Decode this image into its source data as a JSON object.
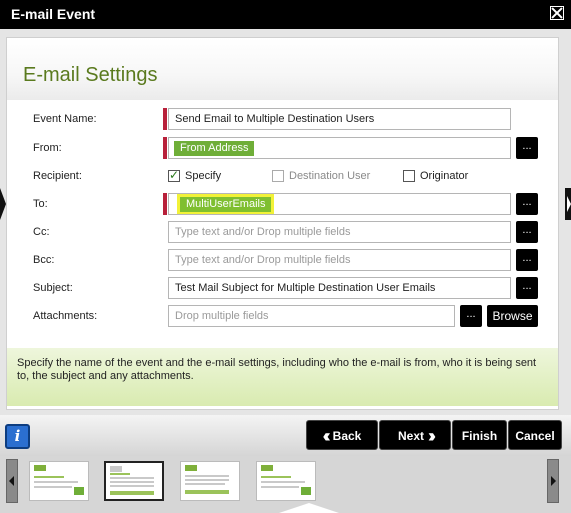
{
  "window": {
    "title": "E-mail Event"
  },
  "heading": "E-mail Settings",
  "form": {
    "event_name": {
      "label": "Event Name:",
      "value": "Send Email to Multiple Destination Users"
    },
    "from": {
      "label": "From:",
      "token": "From Address"
    },
    "recipient": {
      "label": "Recipient:",
      "options": [
        {
          "label": "Specify",
          "checked": true,
          "enabled": true
        },
        {
          "label": "Destination User",
          "checked": false,
          "enabled": false
        },
        {
          "label": "Originator",
          "checked": false,
          "enabled": true
        }
      ]
    },
    "to": {
      "label": "To:",
      "token": "MultiUserEmails"
    },
    "cc": {
      "label": "Cc:",
      "placeholder": "Type text and/or Drop multiple fields"
    },
    "bcc": {
      "label": "Bcc:",
      "placeholder": "Type text and/or Drop multiple fields"
    },
    "subject": {
      "label": "Subject:",
      "value": "Test Mail Subject  for Multiple Destination User Emails"
    },
    "attachments": {
      "label": "Attachments:",
      "placeholder": "Drop multiple fields",
      "browse_label": "Browse"
    }
  },
  "help_text": "Specify the name of the event and the e-mail settings, including who the e-mail is from, who it is being sent to, the subject and any attachments.",
  "nav": {
    "back": "Back",
    "next": "Next",
    "finish": "Finish",
    "cancel": "Cancel",
    "info_icon": "i"
  },
  "thumbnails": {
    "selected_index": 1,
    "count": 4
  },
  "colors": {
    "heading": "#5a7a1e",
    "token_green": "#6fae38",
    "required": "#b8203a",
    "highlight": "#f2f238",
    "info_blue": "#2b6fd0"
  }
}
